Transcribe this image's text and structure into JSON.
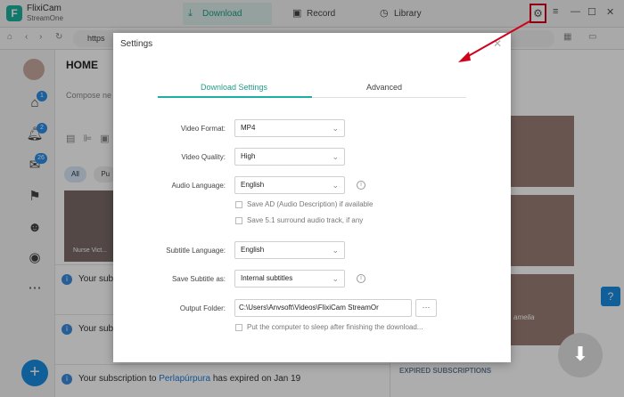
{
  "app": {
    "name": "FlixiCam",
    "sub": "StreamOne"
  },
  "tabs": [
    {
      "label": "Download"
    },
    {
      "label": "Record"
    },
    {
      "label": "Library"
    }
  ],
  "address": {
    "url": "https"
  },
  "sidebar": {
    "badges": [
      "1",
      "2",
      "26"
    ]
  },
  "home": {
    "title": "HOME",
    "compose_placeholder": "Compose ne",
    "chips": [
      "All",
      "Pu"
    ],
    "card_label": "Nurse Vict..."
  },
  "notifications": [
    {
      "text": "Your subs"
    },
    {
      "text": "Your sub"
    },
    {
      "prefix": "Your subscription to ",
      "link": "Perlapúrpura",
      "suffix": " has expired on Jan 19"
    }
  ],
  "right_panel": {
    "expired_label": "EXPIRED SUBSCRIPTIONS",
    "thumb_caption": "amelia"
  },
  "settings": {
    "title": "Settings",
    "tabs": {
      "download": "Download Settings",
      "advanced": "Advanced"
    },
    "video_format": {
      "label": "Video Format:",
      "value": "MP4"
    },
    "video_quality": {
      "label": "Video Quality:",
      "value": "High"
    },
    "audio_language": {
      "label": "Audio Language:",
      "value": "English"
    },
    "save_ad": "Save AD (Audio Description) if available",
    "save_51": "Save 5.1 surround audio track, if any",
    "subtitle_language": {
      "label": "Subtitle Language:",
      "value": "English"
    },
    "save_subtitle_as": {
      "label": "Save Subtitle as:",
      "value": "Internal subtitles"
    },
    "output_folder": {
      "label": "Output Folder:",
      "value": "C:\\Users\\Anvsoft\\Videos\\FlixiCam StreamOr",
      "browse": "···"
    },
    "sleep": "Put the computer to sleep after finishing the download..."
  },
  "colors": {
    "accent": "#1bb1a0",
    "highlight": "#d0021b",
    "blue": "#1a8de0"
  }
}
